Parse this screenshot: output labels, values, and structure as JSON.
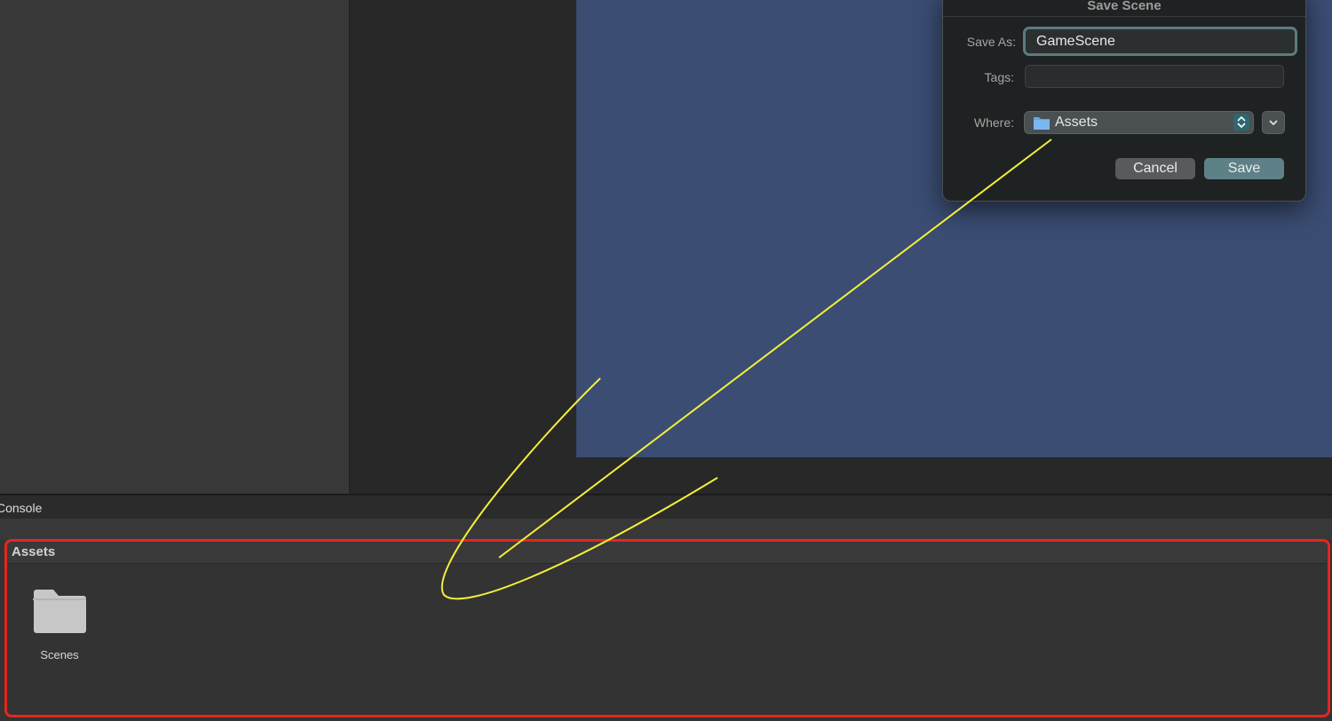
{
  "console": {
    "tab_label": "Console"
  },
  "project": {
    "header": "Assets",
    "items": [
      {
        "label": "Scenes",
        "icon": "folder-icon"
      }
    ]
  },
  "dialog": {
    "title": "Save Scene",
    "save_as_label": "Save As:",
    "save_as_value": "GameScene",
    "tags_label": "Tags:",
    "tags_value": "",
    "where_label": "Where:",
    "where_value": "Assets",
    "cancel_label": "Cancel",
    "save_label": "Save"
  },
  "colors": {
    "scene_background": "#3b4d73",
    "highlight_border": "#e2271f",
    "annotation_stroke": "#f2f03a",
    "primary_button": "#5d8187"
  }
}
